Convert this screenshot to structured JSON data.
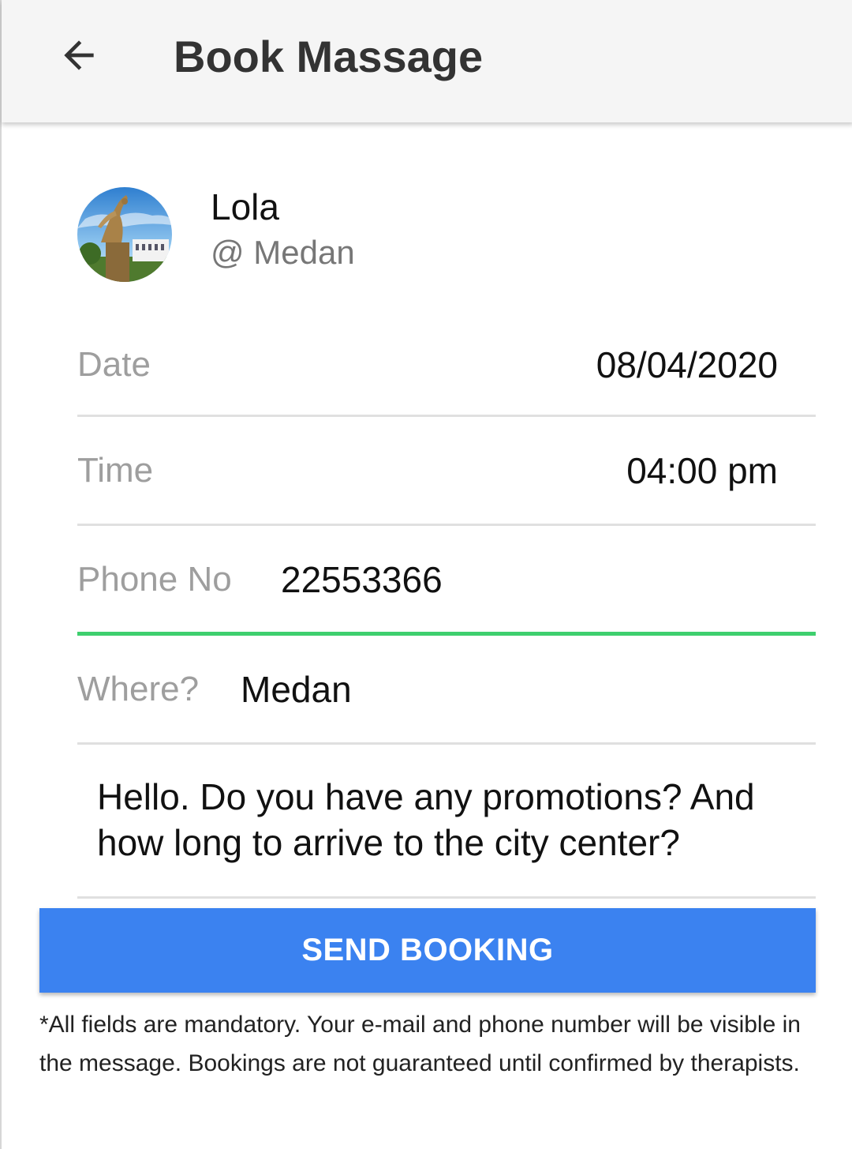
{
  "appbar": {
    "back_icon": "arrow-left-icon",
    "title": "Book Massage"
  },
  "profile": {
    "name": "Lola",
    "location": "@ Medan",
    "avatar_icon": "statue-photo-avatar"
  },
  "form": {
    "date": {
      "label": "Date",
      "value": "08/04/2020"
    },
    "time": {
      "label": "Time",
      "value": "04:00 pm"
    },
    "phone": {
      "label": "Phone No",
      "value": "22553366"
    },
    "where": {
      "label": "Where?",
      "value": "Medan"
    },
    "message": "Hello. Do you have any promotions? And how long to arrive to the city center?"
  },
  "send_button": {
    "label": "SEND BOOKING"
  },
  "note": "*All fields are mandatory. Your e-mail and phone number will be visible in the message. Bookings are not guaranteed until confirmed by therapists.",
  "colors": {
    "accent": "#3b82f0",
    "active_underline": "#3ecf6e",
    "appbar_bg": "#f5f5f5"
  }
}
